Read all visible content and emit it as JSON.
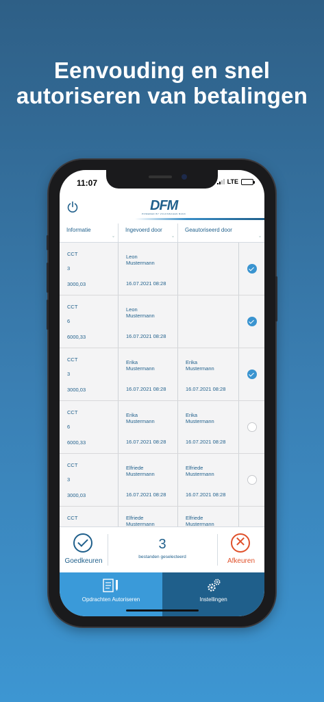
{
  "headline": {
    "line1": "Eenvouding en snel",
    "line2": "autoriseren van betalingen"
  },
  "status_bar": {
    "time": "11:07",
    "network": "LTE"
  },
  "header": {
    "logo_text": "DFM",
    "logo_sub": "POWERED BY VOLKSWAGEN BANK"
  },
  "columns": {
    "info": "Informatie",
    "entered_by": "Ingevoerd door",
    "authorized_by": "Geautoriseerd door"
  },
  "rows": [
    {
      "type": "CCT",
      "number": "3",
      "amount": "3000,03",
      "entered_name_1": "Leon",
      "entered_name_2": "Mustermann",
      "entered_date": "16.07.2021 08:28",
      "auth_name_1": "",
      "auth_name_2": "",
      "auth_date": "",
      "selected": true
    },
    {
      "type": "CCT",
      "number": "6",
      "amount": "6000,33",
      "entered_name_1": "Leon",
      "entered_name_2": "Mustermann",
      "entered_date": "16.07.2021 08:28",
      "auth_name_1": "",
      "auth_name_2": "",
      "auth_date": "",
      "selected": true
    },
    {
      "type": "CCT",
      "number": "3",
      "amount": "3000,03",
      "entered_name_1": "Erika",
      "entered_name_2": "Mustermann",
      "entered_date": "16.07.2021 08:28",
      "auth_name_1": "Erika",
      "auth_name_2": "Mustermann",
      "auth_date": "16.07.2021 08:28",
      "selected": true
    },
    {
      "type": "CCT",
      "number": "6",
      "amount": "6000,33",
      "entered_name_1": "Erika",
      "entered_name_2": "Mustermann",
      "entered_date": "16.07.2021 08:28",
      "auth_name_1": "Erika",
      "auth_name_2": "Mustermann",
      "auth_date": "16.07.2021 08:28",
      "selected": false
    },
    {
      "type": "CCT",
      "number": "3",
      "amount": "3000,03",
      "entered_name_1": "Elfriede",
      "entered_name_2": "Mustermann",
      "entered_date": "16.07.2021 08:28",
      "auth_name_1": "Elfriede",
      "auth_name_2": "Mustermann",
      "auth_date": "16.07.2021 08:28",
      "selected": false
    },
    {
      "type": "CCT",
      "number": "",
      "amount": "",
      "entered_name_1": "Elfriede",
      "entered_name_2": "Mustermann",
      "entered_date": "",
      "auth_name_1": "Elfriede",
      "auth_name_2": "Mustermann",
      "auth_date": "",
      "selected": false
    }
  ],
  "actions": {
    "approve_label": "Goedkeuren",
    "selected_count": "3",
    "selected_label": "bestanden geselecteerd",
    "reject_label": "Afkeuren"
  },
  "tabs": {
    "authorize_label": "Opdrachten Autoriseren",
    "settings_label": "Instellingen"
  },
  "colors": {
    "brand_dark": "#1f5f8b",
    "brand_light": "#3a9ad9",
    "reject": "#e0502a"
  }
}
